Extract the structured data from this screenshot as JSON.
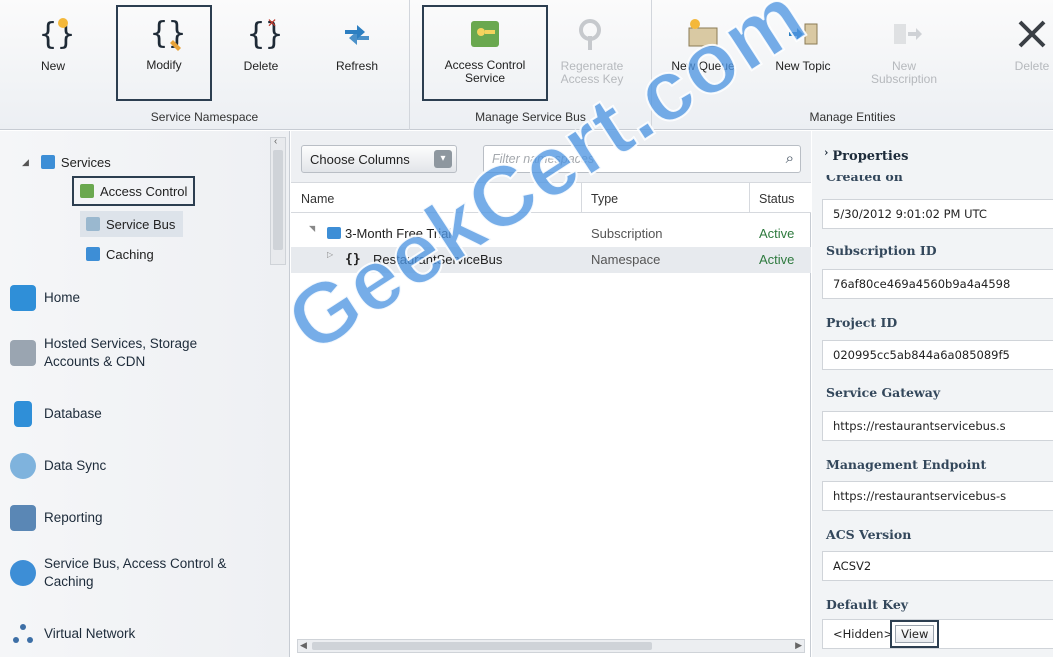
{
  "ribbon": {
    "groups": [
      {
        "label": "Service Namespace",
        "buttons": [
          {
            "label": "New"
          },
          {
            "label": "Modify"
          },
          {
            "label": "Delete"
          },
          {
            "label": "Refresh"
          }
        ]
      },
      {
        "label": "Manage Service Bus",
        "buttons": [
          {
            "label": "Access Control Service"
          },
          {
            "label": "Regenerate Access Key"
          }
        ]
      },
      {
        "label": "Manage Entities",
        "buttons": [
          {
            "label": "New Queue"
          },
          {
            "label": "New Topic"
          },
          {
            "label": "New Subscription"
          },
          {
            "label": "Delete"
          }
        ]
      }
    ]
  },
  "tree": {
    "root": "Services",
    "children": [
      "Access Control",
      "Service Bus",
      "Caching"
    ]
  },
  "nav": {
    "items": [
      {
        "label": "Home",
        "icon": "home-icon"
      },
      {
        "label": "Hosted Services, Storage Accounts & CDN",
        "icon": "hosted-services-icon"
      },
      {
        "label": "Database",
        "icon": "database-icon"
      },
      {
        "label": "Data Sync",
        "icon": "data-sync-icon"
      },
      {
        "label": "Reporting",
        "icon": "reporting-icon"
      },
      {
        "label": "Service Bus, Access Control & Caching",
        "icon": "service-bus-icon"
      },
      {
        "label": "Virtual Network",
        "icon": "virtual-network-icon"
      }
    ]
  },
  "list": {
    "choose_columns": "Choose Columns",
    "filter_placeholder": "Filter namespaces",
    "columns": [
      "Name",
      "Type",
      "Status"
    ],
    "rows": [
      {
        "name": "3-Month Free Trial",
        "type": "Subscription",
        "status": "Active"
      },
      {
        "name": "RestaurantServiceBus",
        "type": "Namespace",
        "status": "Active"
      }
    ]
  },
  "properties": {
    "title": "Properties",
    "fields": [
      {
        "label": "Created on",
        "value": "5/30/2012 9:01:02 PM UTC"
      },
      {
        "label": "Subscription ID",
        "value": "76af80ce469a4560b9a4a4598"
      },
      {
        "label": "Project ID",
        "value": "020995cc5ab844a6a085089f5"
      },
      {
        "label": "Service Gateway",
        "value": "https://restaurantservicebus.s"
      },
      {
        "label": "Management Endpoint",
        "value": "https://restaurantservicebus-s"
      },
      {
        "label": "ACS Version",
        "value": "ACSV2"
      },
      {
        "label": "Default Key",
        "value": "<Hidden>",
        "button": "View"
      }
    ]
  },
  "watermark": "GeekCert.com",
  "colors": {
    "accent": "#2c3e50",
    "status_active": "#2e7a3e",
    "watermark": "#5096e1"
  }
}
